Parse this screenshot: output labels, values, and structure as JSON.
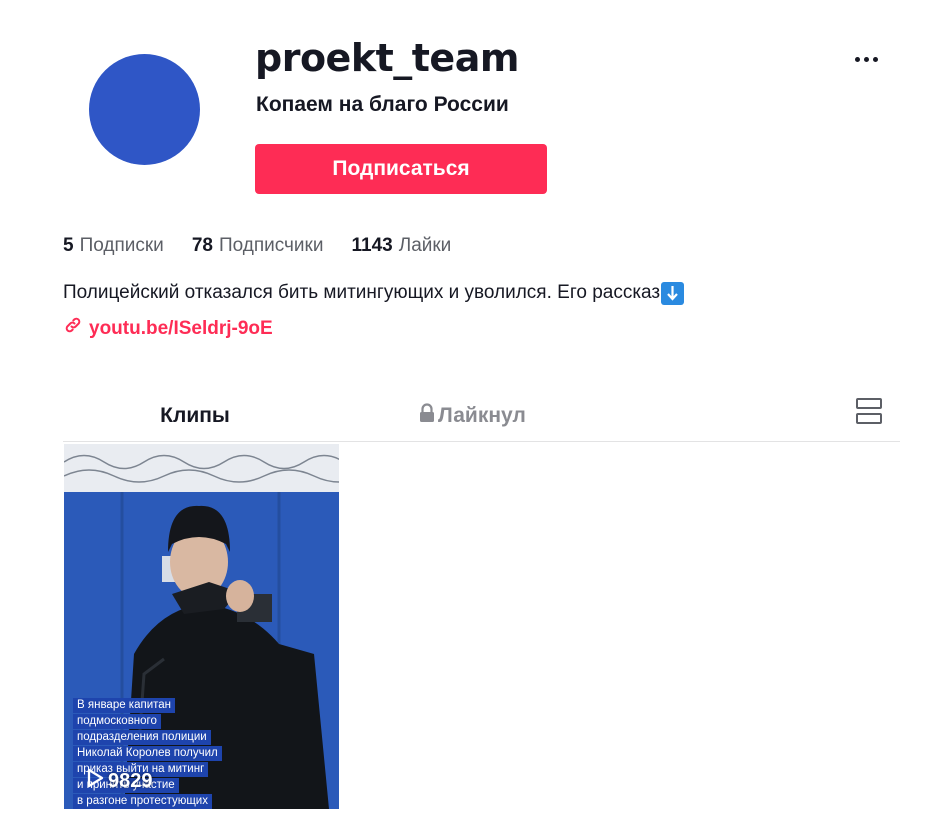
{
  "profile": {
    "username": "proekt_team",
    "nickname": "Копаем на благо России",
    "avatar_color": "#2f56c6",
    "follow_label": "Подписаться",
    "follow_color": "#fe2c55",
    "more_icon": "more-horizontal-icon"
  },
  "stats": {
    "following_count": "5",
    "following_label": "Подписки",
    "followers_count": "78",
    "followers_label": "Подписчики",
    "likes_count": "1143",
    "likes_label": "Лайки"
  },
  "bio": {
    "text": "Полицейский отказался бить митингующих и уволился. Его рассказ",
    "emoji_icon": "down-arrow-emoji-icon"
  },
  "link": {
    "text": "youtube/ISeldrj-9oE",
    "text_display": "youtu.be/ISeldrj-9oE",
    "color": "#fe2c55",
    "icon": "link-icon"
  },
  "tabs": {
    "clips_label": "Клипы",
    "liked_label": "Лайкнул",
    "liked_icon": "lock-icon",
    "layout_icon": "layout-toggle-icon"
  },
  "videos": [
    {
      "caption_lines": [
        "В январе капитан",
        "подмосковного",
        "подразделения полиции",
        "Николай Королев получил",
        "приказ выйти на митинг",
        "и принять участие",
        "в разгоне протестующих"
      ],
      "views": "9829",
      "play_icon": "play-icon"
    }
  ]
}
